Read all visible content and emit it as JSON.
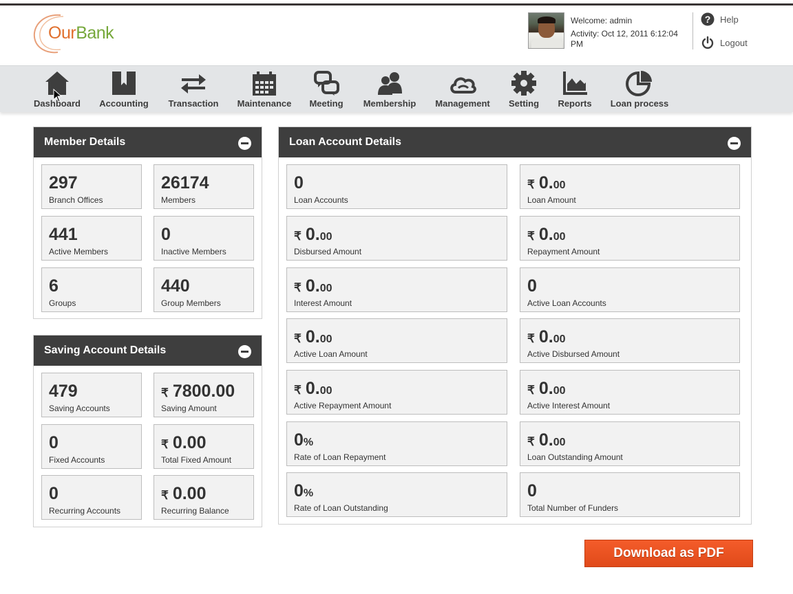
{
  "brand": {
    "logo_part1": "Our",
    "logo_part2": "Bank",
    "orange": "#e0702e",
    "green": "#76a83b"
  },
  "user": {
    "welcome": "Welcome: admin",
    "activity": "Activity: Oct 12, 2011 6:12:04 PM"
  },
  "header_links": {
    "help": "Help",
    "logout": "Logout"
  },
  "nav": [
    {
      "label": "Dashboard",
      "icon": "home-icon"
    },
    {
      "label": "Accounting",
      "icon": "bookmark-icon"
    },
    {
      "label": "Transaction",
      "icon": "transfer-arrows-icon"
    },
    {
      "label": "Maintenance",
      "icon": "calendar-icon"
    },
    {
      "label": "Meeting",
      "icon": "chat-bubbles-icon"
    },
    {
      "label": "Membership",
      "icon": "users-icon"
    },
    {
      "label": "Management",
      "icon": "cloud-icon"
    },
    {
      "label": "Setting",
      "icon": "gear-icon"
    },
    {
      "label": "Reports",
      "icon": "area-chart-icon"
    },
    {
      "label": "Loan process",
      "icon": "pie-chart-icon"
    }
  ],
  "member_details": {
    "title": "Member Details",
    "stats": [
      {
        "value": "297",
        "label": "Branch Offices"
      },
      {
        "value": "26174",
        "label": "Members"
      },
      {
        "value": "441",
        "label": "Active Members"
      },
      {
        "value": "0",
        "label": "Inactive Members"
      },
      {
        "value": "6",
        "label": "Groups"
      },
      {
        "value": "440",
        "label": "Group Members"
      }
    ]
  },
  "saving_details": {
    "title": "Saving Account Details",
    "stats": [
      {
        "value": "479",
        "label": "Saving Accounts"
      },
      {
        "currency": "₹",
        "value": "7800.00",
        "label": "Saving Amount"
      },
      {
        "value": "0",
        "label": "Fixed Accounts"
      },
      {
        "currency": "₹",
        "value": "0.00",
        "label": "Total Fixed Amount"
      },
      {
        "value": "0",
        "label": "Recurring Accounts"
      },
      {
        "currency": "₹",
        "value": "0.00",
        "label": "Recurring Balance"
      }
    ]
  },
  "loan_details": {
    "title": "Loan Account Details",
    "stats": [
      {
        "value": "0",
        "label": "Loan Accounts"
      },
      {
        "currency": "₹",
        "value": "0.",
        "fraction": "00",
        "label": "Loan Amount"
      },
      {
        "currency": "₹",
        "value": "0.",
        "fraction": "00",
        "label": "Disbursed Amount"
      },
      {
        "currency": "₹",
        "value": "0.",
        "fraction": "00",
        "label": "Repayment Amount"
      },
      {
        "currency": "₹",
        "value": "0.",
        "fraction": "00",
        "label": "Interest Amount"
      },
      {
        "value": "0",
        "label": "Active Loan Accounts"
      },
      {
        "currency": "₹",
        "value": "0.",
        "fraction": "00",
        "label": "Active Loan Amount"
      },
      {
        "currency": "₹",
        "value": "0.",
        "fraction": "00",
        "label": "Active Disbursed Amount"
      },
      {
        "currency": "₹",
        "value": "0.",
        "fraction": "00",
        "label": "Active Repayment Amount"
      },
      {
        "currency": "₹",
        "value": "0.",
        "fraction": "00",
        "label": "Active Interest Amount"
      },
      {
        "value": "0",
        "unit": "%",
        "label": "Rate of Loan Repayment"
      },
      {
        "currency": "₹",
        "value": "0.",
        "fraction": "00",
        "label": "Loan Outstanding Amount"
      },
      {
        "value": "0",
        "unit": "%",
        "label": "Rate of Loan Outstanding"
      },
      {
        "value": "0",
        "label": "Total Number of Funders"
      }
    ]
  },
  "download_button": "Download as PDF"
}
